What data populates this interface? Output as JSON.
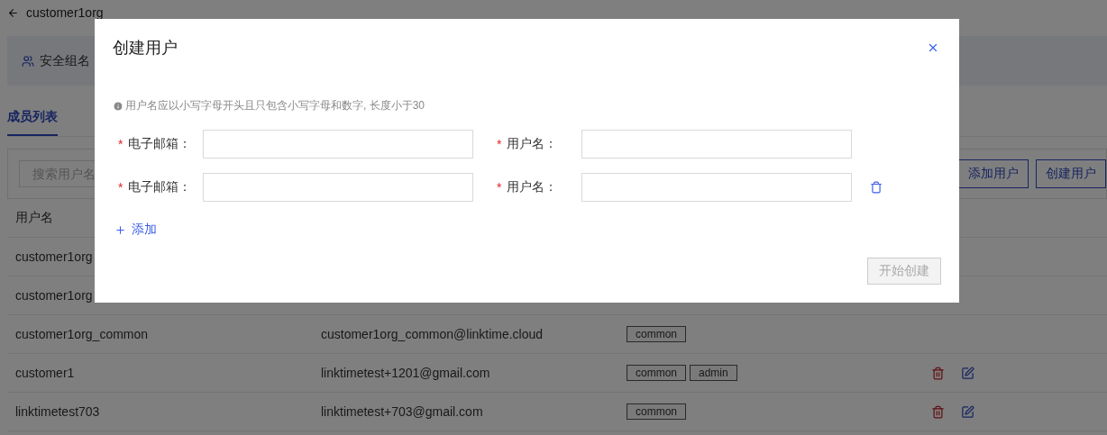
{
  "header": {
    "title": "customer1org"
  },
  "banner": {
    "text": "安全组名"
  },
  "tabs": [
    {
      "label": "成员列表",
      "selected": true
    }
  ],
  "toolbar": {
    "search": {
      "placeholder": "搜索用户名"
    },
    "buttons": [
      "添加用户",
      "创建用户"
    ]
  },
  "table": {
    "columns": [
      "用户名"
    ],
    "rows": [
      {
        "username": "customer1org"
      },
      {
        "username": "customer1org"
      },
      {
        "username": "customer1org_common",
        "email": "customer1org_common@linktime.cloud",
        "roles": [
          "common"
        ],
        "actions": false
      },
      {
        "username": "customer1",
        "email": "linktimetest+1201@gmail.com",
        "roles": [
          "common",
          "admin"
        ],
        "actions": true
      },
      {
        "username": "linktimetest703",
        "email": "linktimetest+703@gmail.com",
        "roles": [
          "common"
        ],
        "actions": true
      }
    ]
  },
  "dialog": {
    "title": "创建用户",
    "hint": "用户名应以小写字母开头且只包含小写字母和数字, 长度小于30",
    "entries": [
      {
        "mark": "*",
        "email_label": "电子邮箱：",
        "username_label": "用户名：",
        "removable": false
      },
      {
        "mark": "*",
        "email_label": "电子邮箱：",
        "username_label": "用户名：",
        "removable": true
      }
    ],
    "add_label": "添加",
    "submit": {
      "label": "开始创建",
      "disabled": true
    }
  }
}
